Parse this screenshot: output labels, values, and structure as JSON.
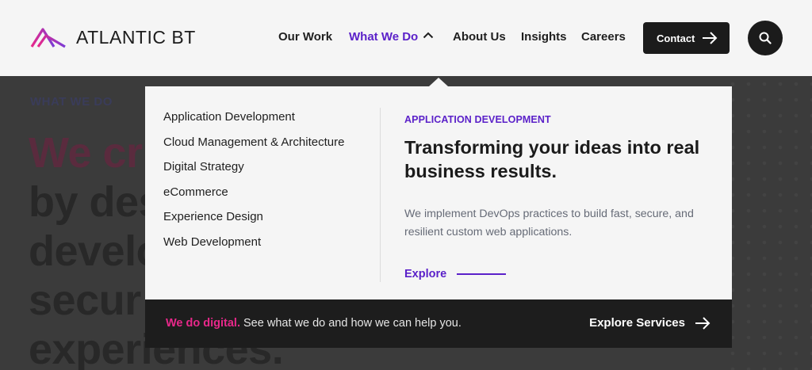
{
  "brand": {
    "name": "ATLANTIC BT",
    "logo_icon": "atlantic-bt-logo-icon",
    "colors": {
      "primary": "#5b21c9",
      "accent": "#e8288a",
      "dark": "#1b1b1b"
    }
  },
  "nav": {
    "items": [
      {
        "label": "Our Work"
      },
      {
        "label": "What We Do"
      },
      {
        "label": "About Us"
      },
      {
        "label": "Insights"
      },
      {
        "label": "Careers"
      }
    ],
    "contact_label": "Contact",
    "search_icon": "search-icon"
  },
  "hero": {
    "eyebrow": "WHAT WE DO",
    "lines": [
      "We cr",
      "by des",
      "develo",
      "secur",
      "experiences."
    ]
  },
  "dropdown": {
    "menu": [
      "Application Development",
      "Cloud Management & Architecture",
      "Digital Strategy",
      "eCommerce",
      "Experience Design",
      "Web Development"
    ],
    "feature": {
      "eyebrow": "APPLICATION DEVELOPMENT",
      "title": "Transforming your ideas into real business results.",
      "description": "We implement DevOps practices to build fast, secure, and resilient custom web applications.",
      "link_label": "Explore"
    },
    "footer": {
      "accent": "We do digital.",
      "text": " See what we do and how we can help you.",
      "cta_label": "Explore Services"
    }
  }
}
